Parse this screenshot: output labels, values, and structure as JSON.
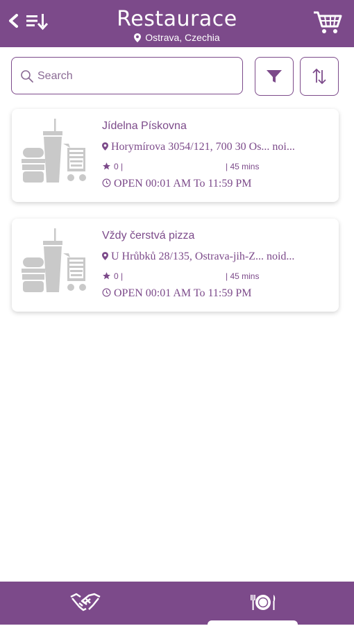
{
  "header": {
    "title": "Restaurace",
    "location": "Ostrava, Czechia",
    "icons": [
      "back-arrow-icon",
      "sort-list-icon",
      "cart-icon"
    ]
  },
  "search": {
    "placeholder": "Search",
    "icons": [
      "search-icon",
      "filter-icon",
      "sort-arrows-icon"
    ]
  },
  "restaurants": [
    {
      "name": "Jídelna Pískovna",
      "address": "Horymírova 3054/121, 700 30 Os... noi...",
      "rating": "0 |",
      "delivery_time": "| 45 mins",
      "hours": "OPEN 00:01 AM To 11:59 PM"
    },
    {
      "name": "Vždy čerstvá pizza",
      "address": "U Hrůbků 28/135, Ostrava-jih-Z... noid...",
      "rating": "0 |",
      "delivery_time": "| 45 mins",
      "hours": "OPEN 00:01 AM To 11:59 PM"
    }
  ],
  "bottom_nav": {
    "tabs": [
      {
        "icon": "handshake-icon",
        "selected": false
      },
      {
        "icon": "dining-plate-icon",
        "selected": true
      }
    ]
  },
  "colors": {
    "brand": "#7c4a8a",
    "placeholder_gray": "#c8c8c8",
    "background": "#ffffff"
  }
}
